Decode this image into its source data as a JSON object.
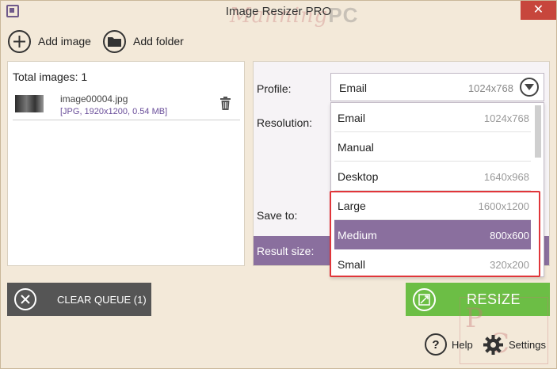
{
  "window": {
    "title": "Image Resizer PRO",
    "close_glyph": "✕"
  },
  "watermark": {
    "script": "Manning",
    "letters": "PC",
    "corner": [
      "P",
      "C"
    ]
  },
  "toolbar": {
    "add_image_label": "Add image",
    "add_folder_label": "Add folder"
  },
  "queue": {
    "total_label": "Total images: 1",
    "items": [
      {
        "name": "image00004.jpg",
        "meta": "[JPG, 1920x1200, 0.54 MB]"
      }
    ],
    "clear_label": "CLEAR QUEUE (1)"
  },
  "settings_panel": {
    "profile_label": "Profile:",
    "resolution_label": "Resolution:",
    "save_to_label": "Save to:",
    "result_size_label": "Result size:",
    "selected_profile": {
      "name": "Email",
      "resolution": "1024x768"
    },
    "options": [
      {
        "name": "Email",
        "resolution": "1024x768"
      },
      {
        "name": "Manual",
        "resolution": ""
      },
      {
        "name": "Desktop",
        "resolution": "1640x968"
      },
      {
        "name": "Large",
        "resolution": "1600x1200"
      },
      {
        "name": "Medium",
        "resolution": "800x600"
      },
      {
        "name": "Small",
        "resolution": "320x200"
      }
    ],
    "highlighted_option": "Medium"
  },
  "actions": {
    "resize_label": "RESIZE",
    "help_label": "Help",
    "settings_label": "Settings",
    "help_glyph": "?"
  },
  "colors": {
    "accent_purple": "#8a6f9e",
    "resize_green": "#6cbe45",
    "clear_gray": "#555555",
    "highlight_red": "#e0363a",
    "close_red": "#c7463c"
  }
}
